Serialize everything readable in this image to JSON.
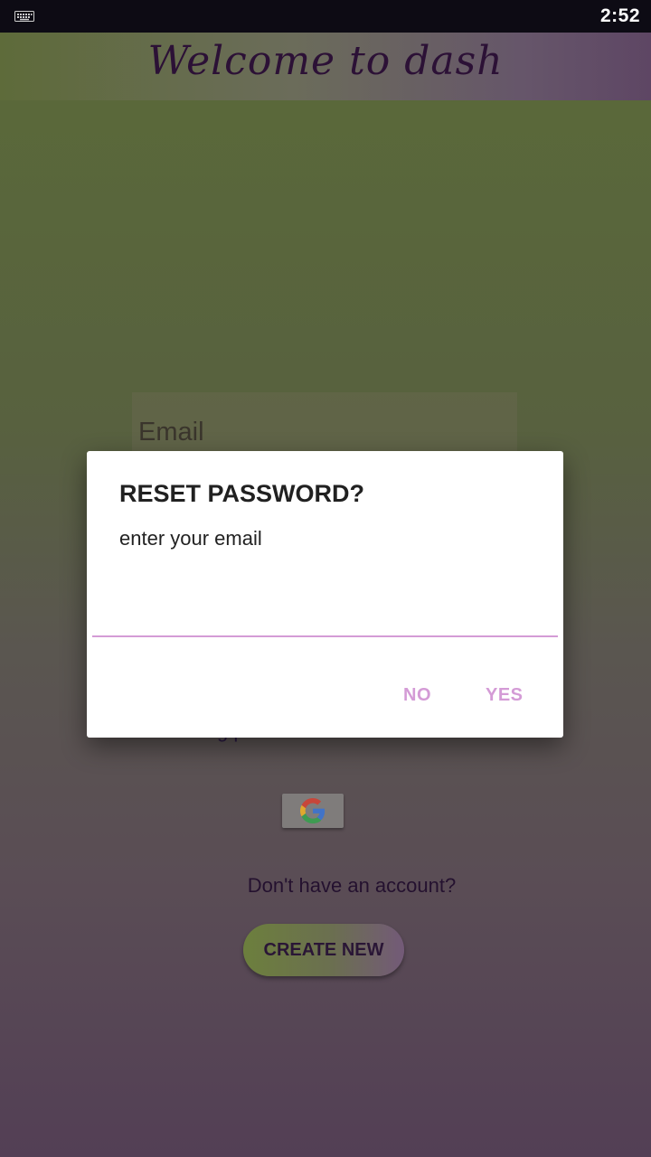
{
  "status_bar": {
    "time": "2:52",
    "left_icon": "keyboard-icon"
  },
  "header": {
    "title": "Welcome to dash"
  },
  "login_form": {
    "email_placeholder": "Email",
    "partial_link_text": "g p"
  },
  "google_button": {
    "icon": "google-icon"
  },
  "signup": {
    "prompt": "Don't have an account?",
    "create_label": "CREATE NEW"
  },
  "dialog": {
    "title": "RESET PASSWORD?",
    "message": "enter your email",
    "input_value": "",
    "no_label": "NO",
    "yes_label": "YES"
  },
  "colors": {
    "accent": "#d49bd6",
    "status_bar": "#0d0b14",
    "title_text": "#2c1136"
  }
}
